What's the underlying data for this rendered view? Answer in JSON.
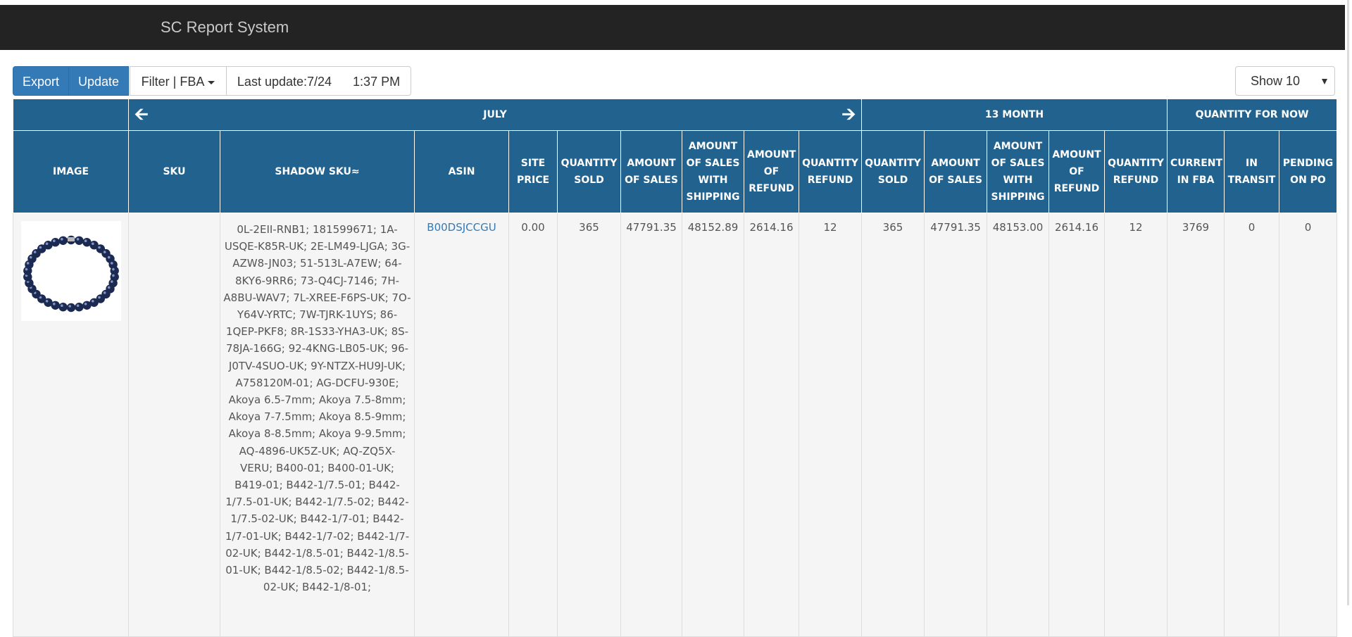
{
  "app": {
    "title": "SC Report System"
  },
  "toolbar": {
    "export_label": "Export",
    "update_label": "Update",
    "filter_label": "Filter | FBA",
    "last_update_label": "Last update:7/24      1:37 PM"
  },
  "page_size": {
    "selected": "Show 10"
  },
  "table": {
    "groups": {
      "month_label": "JULY",
      "thirteen_month_label": "13 MONTH",
      "quantity_now_label": "QUANTITY FOR NOW"
    },
    "headers": {
      "image": "IMAGE",
      "sku": "SKU",
      "shadow_skus": "SHADOW SKU≈",
      "asin": "ASIN",
      "site_price": "SITE PRICE",
      "m_quantity_sold": "QUANTITY SOLD",
      "m_amount_sales": "AMOUNT OF SALES",
      "m_amount_sales_shipping": "AMOUNT OF SALES WITH SHIPPING",
      "m_amount_refund": "AMOUNT OF REFUND",
      "m_quantity_refund": "QUANTITY REFUND",
      "y_quantity_sold": "QUANTITY SOLD",
      "y_amount_sales": "AMOUNT OF SALES",
      "y_amount_sales_shipping": "AMOUNT OF SALES WITH SHIPPING",
      "y_amount_refund": "AMOUNT OF REFUND",
      "y_quantity_refund": "QUANTITY REFUND",
      "current_fba": "CURRENT IN FBA",
      "in_transit": "IN TRANSIT",
      "pending_po": "PENDING ON PO"
    },
    "row": {
      "sku": "",
      "shadow_skus": "0L-2EII-RNB1; 181599671; 1A-USQE-K85R-UK; 2E-LM49-LJGA; 3G-AZW8-JN03; 51-513L-A7EW; 64-8KY6-9RR6; 73-Q4CJ-7146; 7H-A8BU-WAV7; 7L-XREE-F6PS-UK; 7O-Y64V-YRTC; 7W-TJRK-1UYS; 86-1QEP-PKF8; 8R-1S33-YHA3-UK; 8S-78JA-166G; 92-4KNG-LB05-UK; 96-J0TV-4SUO-UK; 9Y-NTZX-HU9J-UK; A758120M-01; AG-DCFU-930E; Akoya 6.5-7mm; Akoya 7.5-8mm; Akoya 7-7.5mm; Akoya 8.5-9mm; Akoya 8-8.5mm; Akoya 9-9.5mm; AQ-4896-UK5Z-UK; AQ-ZQ5X-VERU; B400-01; B400-01-UK; B419-01; B442-1/7.5-01; B442-1/7.5-01-UK; B442-1/7.5-02; B442-1/7.5-02-UK; B442-1/7-01; B442-1/7-01-UK; B442-1/7-02; B442-1/7-02-UK; B442-1/8.5-01; B442-1/8.5-01-UK; B442-1/8.5-02; B442-1/8.5-02-UK; B442-1/8-01;",
      "asin": "B00DSJCCGU",
      "site_price": "0.00",
      "m_quantity_sold": "365",
      "m_amount_sales": "47791.35",
      "m_amount_sales_shipping": "48152.89",
      "m_amount_refund": "2614.16",
      "m_quantity_refund": "12",
      "y_quantity_sold": "365",
      "y_amount_sales": "47791.35",
      "y_amount_sales_shipping": "48153.00",
      "y_amount_refund": "2614.16",
      "y_quantity_refund": "12",
      "current_fba": "3769",
      "in_transit": "0",
      "pending_po": "0"
    }
  },
  "colors": {
    "navbar": "#232323",
    "header": "#22628f",
    "primary_button": "#337ab7",
    "link": "#337ab7",
    "pearl": "#1c2a52"
  }
}
